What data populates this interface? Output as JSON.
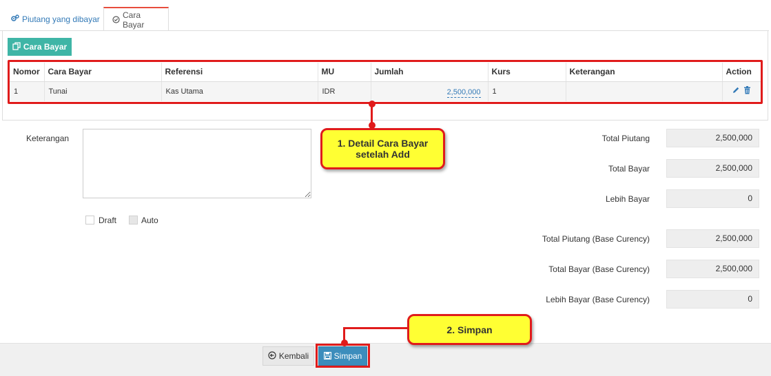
{
  "tabs": {
    "piutang_label": "Piutang yang dibayar",
    "cara_label": "Cara Bayar"
  },
  "toolbar": {
    "add_label": "Cara Bayar"
  },
  "table": {
    "headers": [
      "Nomor",
      "Cara Bayar",
      "Referensi",
      "MU",
      "Jumlah",
      "Kurs",
      "Keterangan",
      "Action"
    ],
    "rows": [
      {
        "nomor": "1",
        "cara_bayar": "Tunai",
        "referensi": "Kas Utama",
        "mu": "IDR",
        "jumlah": "2,500,000",
        "kurs": "1",
        "keterangan": ""
      }
    ]
  },
  "form": {
    "keterangan_label": "Keterangan",
    "keterangan_value": "",
    "draft_label": "Draft",
    "auto_label": "Auto"
  },
  "totals": {
    "total_piutang_label": "Total Piutang",
    "total_piutang_value": "2,500,000",
    "total_bayar_label": "Total Bayar",
    "total_bayar_value": "2,500,000",
    "lebih_bayar_label": "Lebih Bayar",
    "lebih_bayar_value": "0",
    "total_piutang_base_label": "Total Piutang (Base Curency)",
    "total_piutang_base_value": "2,500,000",
    "total_bayar_base_label": "Total Bayar (Base Curency)",
    "total_bayar_base_value": "2,500,000",
    "lebih_bayar_base_label": "Lebih Bayar (Base Curency)",
    "lebih_bayar_base_value": "0"
  },
  "callouts": {
    "c1_line1": "1. Detail Cara Bayar",
    "c1_line2": "setelah Add",
    "c2": "2. Simpan"
  },
  "footer": {
    "kembali_label": "Kembali",
    "simpan_label": "Simpan"
  },
  "colors": {
    "accent_teal": "#3fb5a6",
    "primary_blue": "#3c8dbc",
    "highlight_red": "#e01b1b",
    "callout_yellow": "#ffff33"
  }
}
